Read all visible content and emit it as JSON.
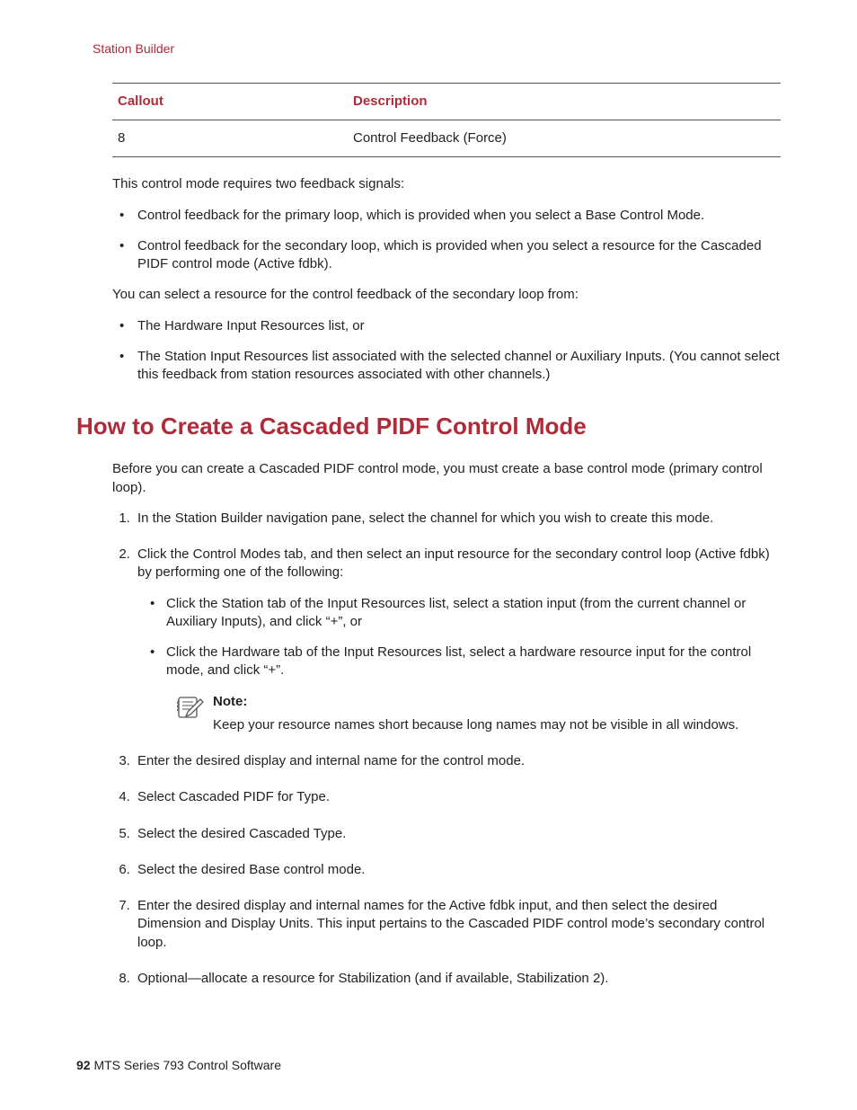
{
  "breadcrumb": "Station Builder",
  "table": {
    "headers": {
      "callout": "Callout",
      "description": "Description"
    },
    "rows": [
      {
        "callout": "8",
        "description": "Control Feedback (Force)"
      }
    ]
  },
  "intro1": "This control mode requires two feedback signals:",
  "intro1_bullets": [
    "Control feedback for the primary loop, which is provided when you select a Base Control Mode.",
    "Control feedback for the secondary loop, which is provided when you select a resource for the Cascaded PIDF control mode (Active fdbk)."
  ],
  "intro2": "You can select a resource for the control feedback of the secondary loop from:",
  "intro2_bullets": [
    "The Hardware Input Resources list, or",
    "The Station Input Resources list associated with the selected channel or Auxiliary Inputs. (You cannot select this feedback from station resources associated with other channels.)"
  ],
  "section_title": "How to Create a Cascaded PIDF Control Mode",
  "section_intro": "Before you can create a Cascaded PIDF control mode, you must create a base control mode (primary control loop).",
  "steps": {
    "s1": "In the Station Builder navigation pane, select the channel for which you wish to create this mode.",
    "s2": "Click the Control Modes tab, and then select an input resource for the secondary control loop (Active fdbk) by performing one of the following:",
    "s2_bullets": [
      "Click the Station tab of the Input Resources list, select a station input (from the current channel or Auxiliary Inputs), and click “+”, or",
      "Click the Hardware tab of the Input Resources list, select a hardware resource input for the control mode, and click “+”."
    ],
    "s2_note_head": "Note:",
    "s2_note_body": "Keep your resource names short because long names may not be visible in all windows.",
    "s3": "Enter the desired display and internal name for the control mode.",
    "s4": "Select Cascaded PIDF for Type.",
    "s5": "Select the desired Cascaded Type.",
    "s6": "Select the desired Base control mode.",
    "s7": "Enter the desired display and internal names for the Active fdbk input, and then select the desired Dimension and Display Units. This input pertains to the Cascaded PIDF control mode’s secondary control loop.",
    "s8": "Optional—allocate a resource for Stabilization (and if available, Stabilization 2)."
  },
  "footer": {
    "page": "92",
    "title": "MTS Series 793 Control Software"
  }
}
